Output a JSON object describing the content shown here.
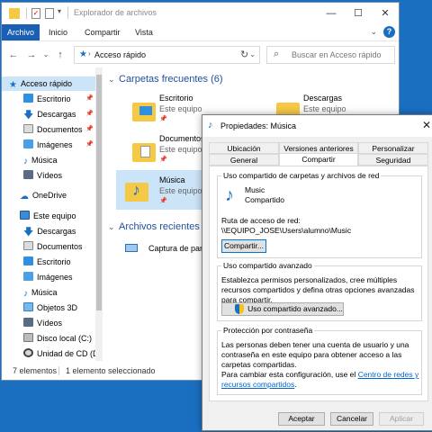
{
  "explorer": {
    "title": "Explorador de archivos",
    "ribbon_tabs": [
      "Archivo",
      "Inicio",
      "Compartir",
      "Vista"
    ],
    "address": "Acceso rápido",
    "search_placeholder": "Buscar en Acceso rápido",
    "nav_items": [
      {
        "label": "Acceso rápido",
        "icon": "star-icon",
        "pinned": false,
        "selected": true
      },
      {
        "label": "Escritorio",
        "icon": "desktop-folder-icon",
        "pinned": true
      },
      {
        "label": "Descargas",
        "icon": "download-arrow-icon",
        "pinned": true
      },
      {
        "label": "Documentos",
        "icon": "documents-folder-icon",
        "pinned": true
      },
      {
        "label": "Imágenes",
        "icon": "pictures-folder-icon",
        "pinned": true
      },
      {
        "label": "Música",
        "icon": "music-note-icon",
        "pinned": false
      },
      {
        "label": "Vídeos",
        "icon": "videos-folder-icon",
        "pinned": false
      },
      {
        "label": "OneDrive",
        "icon": "cloud-icon",
        "pinned": false
      },
      {
        "label": "Este equipo",
        "icon": "computer-icon",
        "pinned": false
      },
      {
        "label": "Descargas",
        "icon": "download-arrow-icon",
        "pinned": false
      },
      {
        "label": "Documentos",
        "icon": "documents-folder-icon",
        "pinned": false
      },
      {
        "label": "Escritorio",
        "icon": "desktop-folder-icon",
        "pinned": false
      },
      {
        "label": "Imágenes",
        "icon": "pictures-folder-icon",
        "pinned": false
      },
      {
        "label": "Música",
        "icon": "music-note-icon",
        "pinned": false
      },
      {
        "label": "Objetos 3D",
        "icon": "cube-icon",
        "pinned": false
      },
      {
        "label": "Vídeos",
        "icon": "videos-folder-icon",
        "pinned": false
      },
      {
        "label": "Disco local (C:)",
        "icon": "drive-icon",
        "pinned": false
      },
      {
        "label": "Unidad de CD (D",
        "icon": "cd-drive-icon",
        "pinned": false
      }
    ],
    "frequent_header": "Carpetas frecuentes (6)",
    "frequent_folders": [
      {
        "name": "Escritorio",
        "location": "Este equipo"
      },
      {
        "name": "Descargas",
        "location": "Este equipo"
      },
      {
        "name": "Documentos",
        "location": "Este equipo"
      },
      {
        "name": "Música",
        "location": "Este equipo"
      }
    ],
    "recent_header": "Archivos recientes (1",
    "recent_files": [
      {
        "name": "Captura de panta"
      }
    ],
    "status_count": "7 elementos",
    "status_selected": "1 elemento seleccionado"
  },
  "dialog": {
    "title": "Propiedades: Música",
    "tabs_row1": [
      "Ubicación",
      "Versiones anteriores",
      "Personalizar"
    ],
    "tabs_row2": [
      "General",
      "Compartir",
      "Seguridad"
    ],
    "active_tab": "Compartir",
    "share_section_title": "Uso compartido de carpetas y archivos de red",
    "folder_name": "Music",
    "share_state": "Compartido",
    "path_label": "Ruta de acceso de red:",
    "path_value": "\\\\EQUIPO_JOSE\\Users\\alumno\\Music",
    "share_button": "Compartir...",
    "advanced_section_title": "Uso compartido avanzado",
    "advanced_text": "Establezca permisos personalizados, cree múltiples recursos compartidos y defina otras opciones avanzadas para compartir.",
    "advanced_button": "Uso compartido avanzado...",
    "password_section_title": "Protección por contraseña",
    "password_text": "Las personas deben tener una cuenta de usuario y una contraseña en este equipo para obtener acceso a las carpetas compartidas.",
    "password_text2": "Para cambiar esta configuración, use el",
    "password_link": "Centro de redes y recursos compartidos",
    "password_text3": ".",
    "ok_button": "Aceptar",
    "cancel_button": "Cancelar",
    "apply_button": "Aplicar"
  },
  "colors": {
    "accent": "#1a5fb4",
    "selection": "#cce4f7",
    "folder": "#f5c945",
    "link": "#0066cc"
  }
}
